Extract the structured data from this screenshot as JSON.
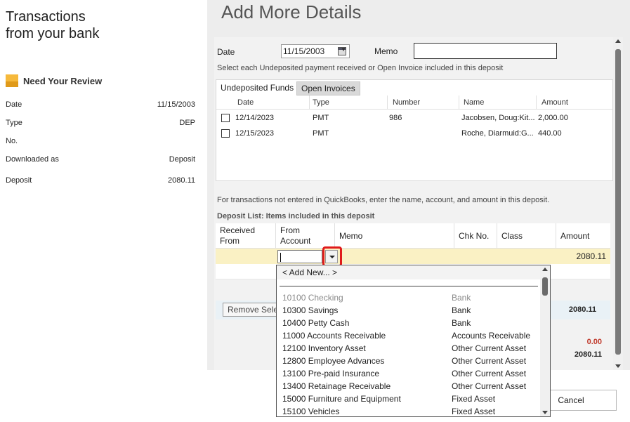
{
  "left_panel": {
    "title_line1": "Transactions",
    "title_line2": "from your bank",
    "review_label": "Need Your Review",
    "fields": [
      {
        "label": "Date",
        "value": "11/15/2003"
      },
      {
        "label": "Type",
        "value": "DEP"
      },
      {
        "label": "No.",
        "value": ""
      },
      {
        "label": "Downloaded as",
        "value": "Deposit"
      },
      {
        "label": "Deposit",
        "value": "2080.11"
      }
    ]
  },
  "form": {
    "heading": "Add More Details",
    "date_label": "Date",
    "date_value": "11/15/2003",
    "memo_label": "Memo",
    "memo_value": "",
    "instruction": "Select each Undeposited payment received or Open Invoice included in this deposit",
    "tabs": [
      {
        "label": "Undeposited Funds",
        "active": true
      },
      {
        "label": "Open Invoices",
        "active": false
      }
    ],
    "payment_columns": [
      "Date",
      "Type",
      "Number",
      "Name",
      "Amount"
    ],
    "payment_rows": [
      {
        "date": "12/14/2023",
        "type": "PMT",
        "number": "986",
        "name": "Jacobsen, Doug:Kit...",
        "amount": "2,000.00",
        "checked": false
      },
      {
        "date": "12/15/2023",
        "type": "PMT",
        "number": "",
        "name": "Roche, Diarmuid:G...",
        "amount": "440.00",
        "checked": false
      }
    ],
    "not_entered_hint": "For transactions not entered in QuickBooks, enter the name, account, and amount in this deposit.",
    "deposit_list_title": "Deposit List: Items included in this deposit",
    "deposit_columns": {
      "received_from_1": "Received",
      "received_from_2": "From",
      "from_account_1": "From",
      "from_account_2": "Account",
      "memo": "Memo",
      "chk_no": "Chk No.",
      "class": "Class",
      "amount": "Amount"
    },
    "deposit_row_amount": "2080.11",
    "remove_button": "Remove Selected",
    "total_1": "2080.11",
    "total_2": "0.00",
    "total_3": "2080.11",
    "cancel_button": "Cancel"
  },
  "account_dropdown": {
    "add_new": "< Add New... >",
    "items": [
      {
        "name": "10100 Checking",
        "type": "Bank",
        "disabled": true
      },
      {
        "name": "10300 Savings",
        "type": "Bank",
        "disabled": false
      },
      {
        "name": "10400 Petty Cash",
        "type": "Bank",
        "disabled": false
      },
      {
        "name": "11000 Accounts Receivable",
        "type": "Accounts Receivable",
        "disabled": false
      },
      {
        "name": "12100 Inventory Asset",
        "type": "Other Current Asset",
        "disabled": false
      },
      {
        "name": "12800 Employee Advances",
        "type": "Other Current Asset",
        "disabled": false
      },
      {
        "name": "13100 Pre-paid Insurance",
        "type": "Other Current Asset",
        "disabled": false
      },
      {
        "name": "13400 Retainage Receivable",
        "type": "Other Current Asset",
        "disabled": false
      },
      {
        "name": "15000 Furniture and Equipment",
        "type": "Fixed Asset",
        "disabled": false
      },
      {
        "name": "15100 Vehicles",
        "type": "Fixed Asset",
        "disabled": false
      }
    ]
  },
  "colors": {
    "highlight_row": "#faf1c4",
    "annotation_red": "#e01b1b",
    "review_icon": "#f6b93b",
    "panel_bg": "#ededed"
  }
}
